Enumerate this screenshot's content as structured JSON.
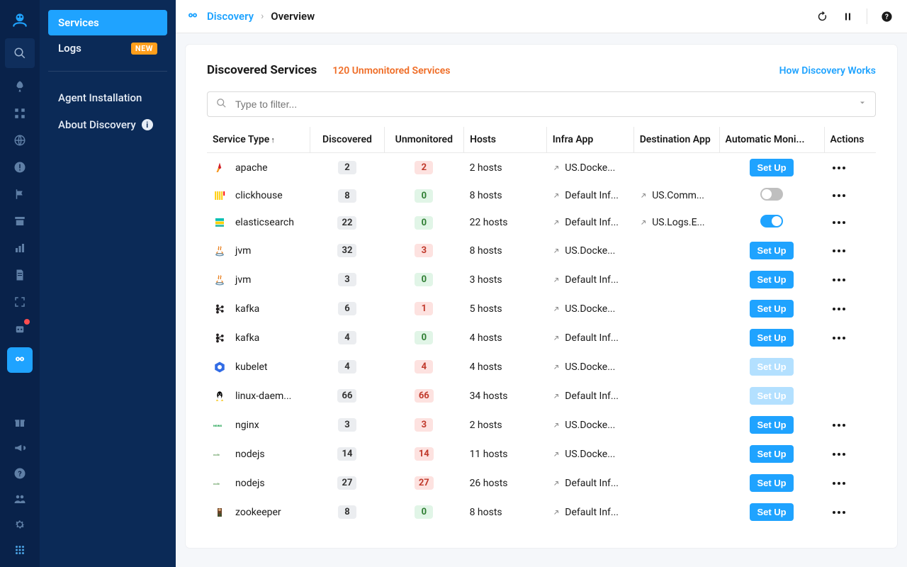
{
  "sidebar": {
    "items": [
      {
        "label": "Services",
        "active": true
      },
      {
        "label": "Logs",
        "badge": "NEW"
      }
    ],
    "links": [
      {
        "label": "Agent Installation"
      },
      {
        "label": "About Discovery",
        "info": true
      }
    ]
  },
  "breadcrumb": {
    "section": "Discovery",
    "page": "Overview"
  },
  "header": {
    "title": "Discovered Services",
    "warn": "120 Unmonitored Services",
    "help_link": "How Discovery Works"
  },
  "filter": {
    "placeholder": "Type to filter..."
  },
  "columns": {
    "service": "Service Type",
    "discovered": "Discovered",
    "unmonitored": "Unmonitored",
    "hosts": "Hosts",
    "infra": "Infra App",
    "dest": "Destination App",
    "auto": "Automatic Moni...",
    "actions": "Actions"
  },
  "setup_label": "Set Up",
  "rows": [
    {
      "icon": "apache",
      "name": "apache",
      "discovered": 2,
      "unmonitored": 2,
      "unm_style": "red",
      "hosts": "2 hosts",
      "infra": "US.Docke...",
      "dest": "",
      "auto": "setup",
      "actions": true
    },
    {
      "icon": "clickhouse",
      "name": "clickhouse",
      "discovered": 8,
      "unmonitored": 0,
      "unm_style": "green",
      "hosts": "8 hosts",
      "infra": "Default Inf...",
      "dest": "US.Comm...",
      "auto": "toggle-off",
      "actions": true
    },
    {
      "icon": "elasticsearch",
      "name": "elasticsearch",
      "discovered": 22,
      "unmonitored": 0,
      "unm_style": "green",
      "hosts": "22 hosts",
      "infra": "Default Inf...",
      "dest": "US.Logs.E...",
      "auto": "toggle-on",
      "actions": true
    },
    {
      "icon": "jvm",
      "name": "jvm",
      "discovered": 32,
      "unmonitored": 3,
      "unm_style": "red",
      "hosts": "8 hosts",
      "infra": "US.Docke...",
      "dest": "",
      "auto": "setup",
      "actions": true
    },
    {
      "icon": "jvm",
      "name": "jvm",
      "discovered": 3,
      "unmonitored": 0,
      "unm_style": "green",
      "hosts": "3 hosts",
      "infra": "Default Inf...",
      "dest": "",
      "auto": "setup",
      "actions": true
    },
    {
      "icon": "kafka",
      "name": "kafka",
      "discovered": 6,
      "unmonitored": 1,
      "unm_style": "red",
      "hosts": "5 hosts",
      "infra": "US.Docke...",
      "dest": "",
      "auto": "setup",
      "actions": true
    },
    {
      "icon": "kafka",
      "name": "kafka",
      "discovered": 4,
      "unmonitored": 0,
      "unm_style": "green",
      "hosts": "4 hosts",
      "infra": "Default Inf...",
      "dest": "",
      "auto": "setup",
      "actions": true
    },
    {
      "icon": "kubelet",
      "name": "kubelet",
      "discovered": 4,
      "unmonitored": 4,
      "unm_style": "red",
      "hosts": "4 hosts",
      "infra": "US.Docke...",
      "dest": "",
      "auto": "setup-disabled",
      "actions": false
    },
    {
      "icon": "linux",
      "name": "linux-daem...",
      "discovered": 66,
      "unmonitored": 66,
      "unm_style": "red",
      "hosts": "34 hosts",
      "infra": "Default Inf...",
      "dest": "",
      "auto": "setup-disabled",
      "actions": false
    },
    {
      "icon": "nginx",
      "name": "nginx",
      "discovered": 3,
      "unmonitored": 3,
      "unm_style": "red",
      "hosts": "2 hosts",
      "infra": "US.Docke...",
      "dest": "",
      "auto": "setup",
      "actions": true
    },
    {
      "icon": "nodejs",
      "name": "nodejs",
      "discovered": 14,
      "unmonitored": 14,
      "unm_style": "red",
      "hosts": "11 hosts",
      "infra": "US.Docke...",
      "dest": "",
      "auto": "setup",
      "actions": true
    },
    {
      "icon": "nodejs",
      "name": "nodejs",
      "discovered": 27,
      "unmonitored": 27,
      "unm_style": "red",
      "hosts": "26 hosts",
      "infra": "Default Inf...",
      "dest": "",
      "auto": "setup",
      "actions": true
    },
    {
      "icon": "zookeeper",
      "name": "zookeeper",
      "discovered": 8,
      "unmonitored": 0,
      "unm_style": "green",
      "hosts": "8 hosts",
      "infra": "Default Inf...",
      "dest": "",
      "auto": "setup",
      "actions": true
    }
  ]
}
